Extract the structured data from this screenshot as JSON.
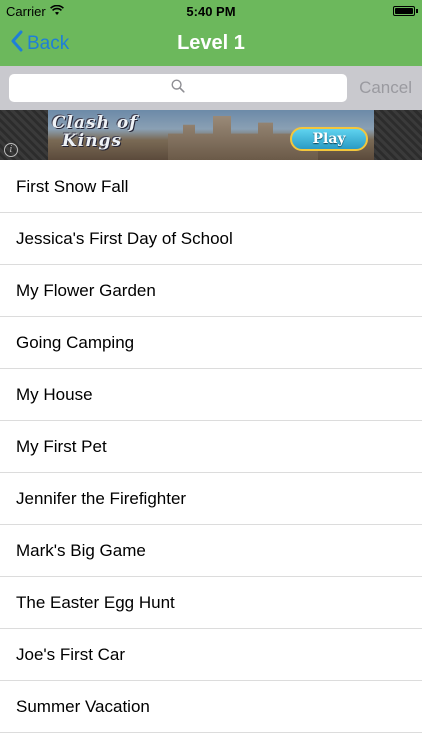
{
  "status_bar": {
    "carrier": "Carrier",
    "time": "5:40 PM",
    "battery_level": 1.0
  },
  "nav": {
    "back_label": "Back",
    "title": "Level 1"
  },
  "search": {
    "placeholder": "",
    "cancel_label": "Cancel"
  },
  "ad": {
    "logo_line1": "Clash of",
    "logo_line2": "Kings",
    "play_label": "Play",
    "info_symbol": "i"
  },
  "stories": [
    "First Snow Fall",
    "Jessica's First Day of School",
    "My Flower Garden",
    "Going Camping",
    "My House",
    "My First Pet",
    "Jennifer the Firefighter",
    "Mark's Big Game",
    "The Easter Egg Hunt",
    "Joe's First Car",
    "Summer Vacation"
  ],
  "colors": {
    "header_green": "#6cb85c",
    "back_blue": "#1e7fd8",
    "search_bar_gray": "#c9c9ce",
    "cancel_gray": "#9a9aa0"
  },
  "icons": {
    "back": "chevron-left-icon",
    "search": "magnifier-icon",
    "wifi": "wifi-icon",
    "battery": "battery-icon",
    "ad_info": "info-icon"
  }
}
